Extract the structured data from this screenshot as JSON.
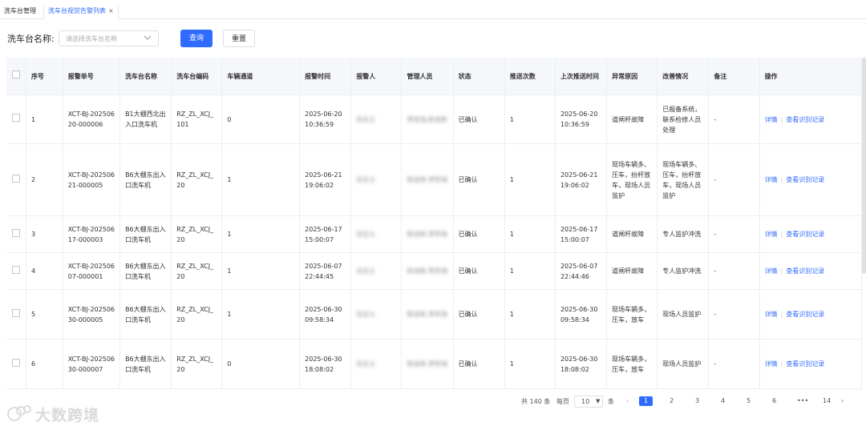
{
  "tabs": [
    {
      "label": "洗车台管理"
    },
    {
      "label": "洗车台视觉告警列表",
      "close": "×"
    }
  ],
  "filter": {
    "label": "洗车台名称:",
    "placeholder": "请选择洗车台名称",
    "query_label": "查询",
    "reset_label": "重置"
  },
  "table": {
    "columns": [
      "序号",
      "报警单号",
      "洗车台名称",
      "洗车台编码",
      "车辆通道",
      "报警时间",
      "报警人",
      "管理人员",
      "状态",
      "推送次数",
      "上次推送时间",
      "异常原因",
      "改善情况",
      "备注",
      "操作"
    ],
    "action_detail": "详情",
    "action_records": "查看识别记录",
    "rows": [
      {
        "no": "1",
        "alarm_id": "XCT-BJ-20250620-000006",
        "name": "B1大棚西北出入口洗车机",
        "code": "RZ_ZL_XCJ_101",
        "lane": "0",
        "time": "2025-06-20 10:36:59",
        "reporter": "孙正士",
        "managers": "李宗海,陈佳新",
        "status": "已确认",
        "push": "1",
        "last_push": "2025-06-20 10:36:59",
        "reason": "道闸杆故障",
        "improve": "已报备系统，联系检修人员处理",
        "remark": "-"
      },
      {
        "no": "2",
        "alarm_id": "XCT-BJ-20250621-000005",
        "name": "B6大棚东出入口洗车机",
        "code": "RZ_ZL_XCJ_20",
        "lane": "1",
        "time": "2025-06-21 19:06:02",
        "reporter": "孙正士",
        "managers": "陈佳新,李宗海",
        "status": "已确认",
        "push": "1",
        "last_push": "2025-06-21 19:06:02",
        "reason": "现场车辆多、压车，抬杆放车，现场人员监护",
        "improve": "现场车辆多、压车，抬杆放车，现场人员监护",
        "remark": "-"
      },
      {
        "no": "3",
        "alarm_id": "XCT-BJ-20250617-000003",
        "name": "B6大棚东出入口洗车机",
        "code": "RZ_ZL_XCJ_20",
        "lane": "1",
        "time": "2025-06-17 15:00:07",
        "reporter": "孙正士",
        "managers": "陈佳新,李宗海",
        "status": "已确认",
        "push": "1",
        "last_push": "2025-06-17 15:00:07",
        "reason": "道闸杆故障",
        "improve": "专人监护冲洗",
        "remark": "-"
      },
      {
        "no": "4",
        "alarm_id": "XCT-BJ-20250607-000001",
        "name": "B6大棚东出入口洗车机",
        "code": "RZ_ZL_XCJ_20",
        "lane": "1",
        "time": "2025-06-07 22:44:45",
        "reporter": "孙正士",
        "managers": "陈佳新,李宗海",
        "status": "已确认",
        "push": "1",
        "last_push": "2025-06-07 22:44:46",
        "reason": "道闸杆故障",
        "improve": "专人监护冲洗",
        "remark": "-"
      },
      {
        "no": "5",
        "alarm_id": "XCT-BJ-20250630-000005",
        "name": "B6大棚东出入口洗车机",
        "code": "RZ_ZL_XCJ_20",
        "lane": "1",
        "time": "2025-06-30 09:58:34",
        "reporter": "孙正士",
        "managers": "陈佳新,李宗海",
        "status": "已确认",
        "push": "1",
        "last_push": "2025-06-30 09:58:34",
        "reason": "现场车辆多，压车，放车",
        "improve": "现场人员监护",
        "remark": "-"
      },
      {
        "no": "6",
        "alarm_id": "XCT-BJ-20250630-000007",
        "name": "B6大棚东出入口洗车机",
        "code": "RZ_ZL_XCJ_20",
        "lane": "0",
        "time": "2025-06-30 18:08:02",
        "reporter": "孙正士",
        "managers": "陈佳新,李宗海",
        "status": "已确认",
        "push": "1",
        "last_push": "2025-06-30 18:08:02",
        "reason": "现场车辆多，压车，放车",
        "improve": "现场人员监护",
        "remark": "-"
      }
    ]
  },
  "pagination": {
    "total_text": "共 140 条",
    "per_page_label": "每页",
    "per_page_value": "10",
    "per_page_unit": "条",
    "pages": [
      "1",
      "2",
      "3",
      "4",
      "5",
      "6"
    ],
    "ellipsis": "•••",
    "last_page": "14",
    "current": "1"
  },
  "watermark": {
    "text": "大数跨境"
  }
}
